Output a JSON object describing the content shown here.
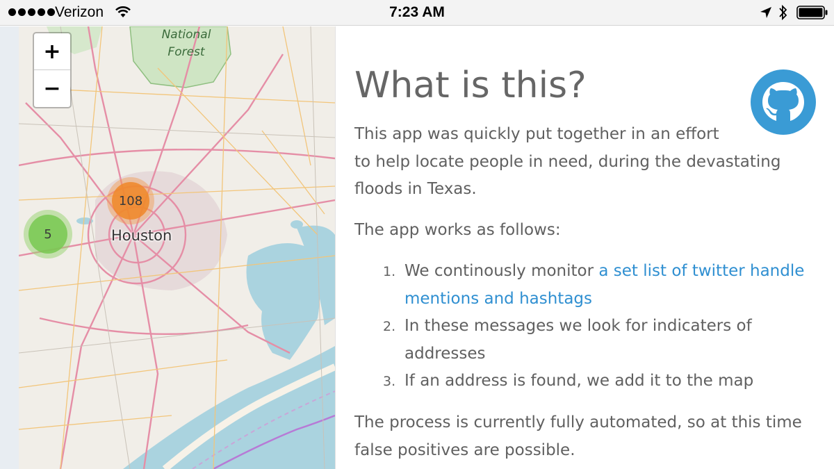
{
  "status_bar": {
    "carrier": "Verizon",
    "time": "7:23 AM",
    "signal_bars": 5
  },
  "map": {
    "zoom_in_label": "+",
    "zoom_out_label": "−",
    "place_labels": {
      "city": "Houston",
      "forest_line1": "National",
      "forest_line2": "Forest"
    },
    "clusters": [
      {
        "count": "108",
        "color": "#f08728"
      },
      {
        "count": "5",
        "color": "#78c850"
      }
    ]
  },
  "content": {
    "title": "What is this?",
    "intro_line1": "This app was quickly put together in an effort",
    "intro_rest": "to help locate people in need, during the devastating floods in Texas.",
    "works_heading": "The app works as follows:",
    "steps": [
      {
        "num": "1.",
        "text": "We continously monitor ",
        "link": "a set list of twitter handle mentions and hashtags"
      },
      {
        "num": "2.",
        "text": "In these messages we look for indicaters of addresses"
      },
      {
        "num": "3.",
        "text": "If an address is found, we add it to the map"
      }
    ],
    "footer": "The process is currently fully automated, so at this time false positives are possible.",
    "link_color": "#2f8fd1",
    "github_color": "#3a9bd5"
  }
}
